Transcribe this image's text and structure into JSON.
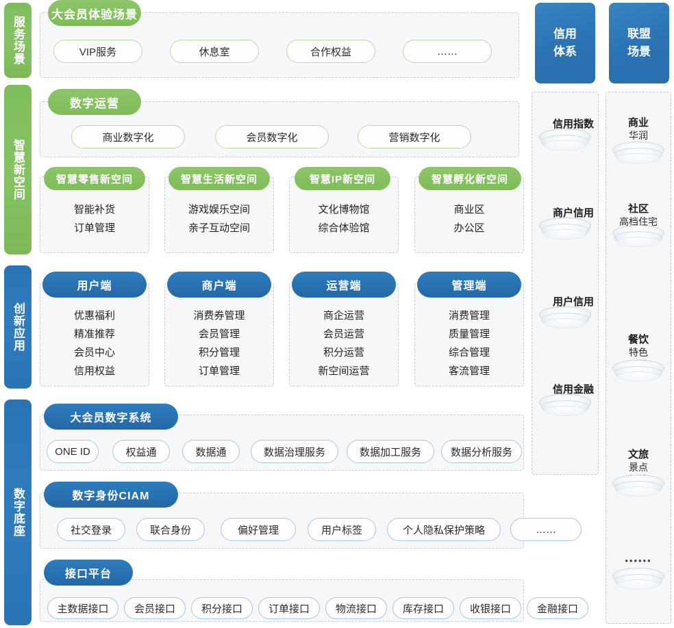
{
  "rails": [
    {
      "id": "service-scenario",
      "label": "服务场景",
      "color": "#7fbe5c"
    },
    {
      "id": "smart-new-space",
      "label": "智慧新空间",
      "color": "#7fbe5c"
    },
    {
      "id": "innovative-application",
      "label": "创新应用",
      "color": "#2a74b4"
    },
    {
      "id": "digital-foundation",
      "label": "数字底座",
      "color": "#2a74b4"
    }
  ],
  "service_scenario": {
    "title": "大会员体验场景",
    "chips": [
      "VIP服务",
      "休息室",
      "合作权益",
      "……"
    ]
  },
  "digital_operation": {
    "title": "数字运营",
    "chips": [
      "商业数字化",
      "会员数字化",
      "营销数字化"
    ]
  },
  "new_spaces": [
    {
      "title": "智慧零售新空间",
      "items": [
        "智能补货",
        "订单管理"
      ]
    },
    {
      "title": "智慧生活新空间",
      "items": [
        "游戏娱乐空间",
        "亲子互动空间"
      ]
    },
    {
      "title": "智慧IP新空间",
      "items": [
        "文化博物馆",
        "综合体验馆"
      ]
    },
    {
      "title": "智慧孵化新空间",
      "items": [
        "商业区",
        "办公区"
      ]
    }
  ],
  "applications": [
    {
      "title": "用户端",
      "items": [
        "优惠福利",
        "精准推荐",
        "会员中心",
        "信用权益"
      ]
    },
    {
      "title": "商户端",
      "items": [
        "消费券管理",
        "会员管理",
        "积分管理",
        "订单管理"
      ]
    },
    {
      "title": "运营端",
      "items": [
        "商企运营",
        "会员运营",
        "积分运营",
        "新空间运营"
      ]
    },
    {
      "title": "管理端",
      "items": [
        "消费管理",
        "质量管理",
        "综合管理",
        "客流管理"
      ]
    }
  ],
  "foundation": [
    {
      "title": "大会员数字系统",
      "chips": [
        "ONE ID",
        "权益通",
        "数据通",
        "数据治理服务",
        "数据加工服务",
        "数据分析服务"
      ]
    },
    {
      "title": "数字身份CIAM",
      "chips": [
        "社交登录",
        "联合身份",
        "偏好管理",
        "用户标签",
        "个人隐私保护策略",
        "……"
      ]
    },
    {
      "title": "接口平台",
      "chips": [
        "主数据接口",
        "会员接口",
        "积分接口",
        "订单接口",
        "物流接口",
        "库存接口",
        "收银接口",
        "金融接口"
      ]
    }
  ],
  "right_columns": [
    {
      "id": "credit-system",
      "header": "信用体系",
      "items": [
        {
          "label": "信用指数",
          "sub": "",
          "dots": false
        },
        {
          "label": "商户信用",
          "sub": "",
          "dots": false
        },
        {
          "label": "用户信用",
          "sub": "",
          "dots": false
        },
        {
          "label": "信用金融",
          "sub": "",
          "dots": false
        }
      ]
    },
    {
      "id": "alliance-scenario",
      "header": "联盟场景",
      "items": [
        {
          "label": "商业",
          "sub": "华润",
          "dots": true
        },
        {
          "label": "社区",
          "sub": "高档住宅",
          "dots": false
        },
        {
          "label": "餐饮",
          "sub": "特色\n品牌",
          "dots": false
        },
        {
          "label": "文旅",
          "sub": "景点\n场馆",
          "dots": false
        },
        {
          "label": "",
          "sub": "",
          "dots": true
        }
      ]
    }
  ],
  "colors": {
    "green": "#7fbe5c",
    "blue": "#2a74b4",
    "panel_bg": "#f6f7f8",
    "chip_border_green": "#b9d9a1",
    "chip_border_blue": "#a9c6e2"
  }
}
